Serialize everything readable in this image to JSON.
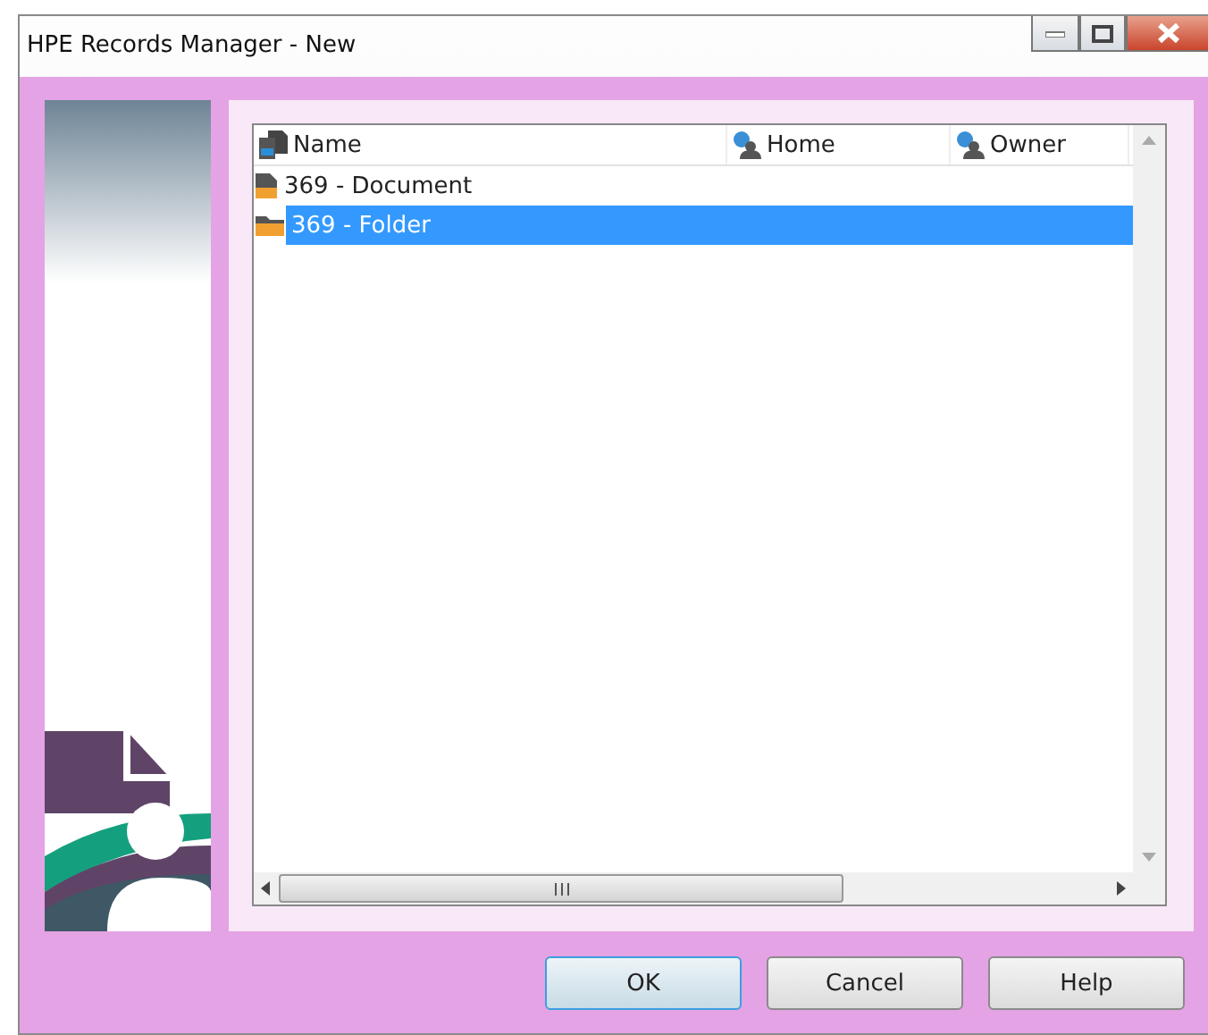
{
  "window": {
    "title": "HPE Records Manager - New"
  },
  "columns": [
    {
      "label": "Name",
      "kind": "name"
    },
    {
      "label": "Home",
      "kind": "location"
    },
    {
      "label": "Owner",
      "kind": "location"
    }
  ],
  "items": [
    {
      "name": "369 - Document",
      "kind": "document",
      "selected": false
    },
    {
      "name": "369 - Folder",
      "kind": "folder",
      "selected": true
    }
  ],
  "buttons": [
    {
      "label": "OK",
      "default": true
    },
    {
      "label": "Cancel",
      "default": false
    },
    {
      "label": "Help",
      "default": false
    }
  ]
}
